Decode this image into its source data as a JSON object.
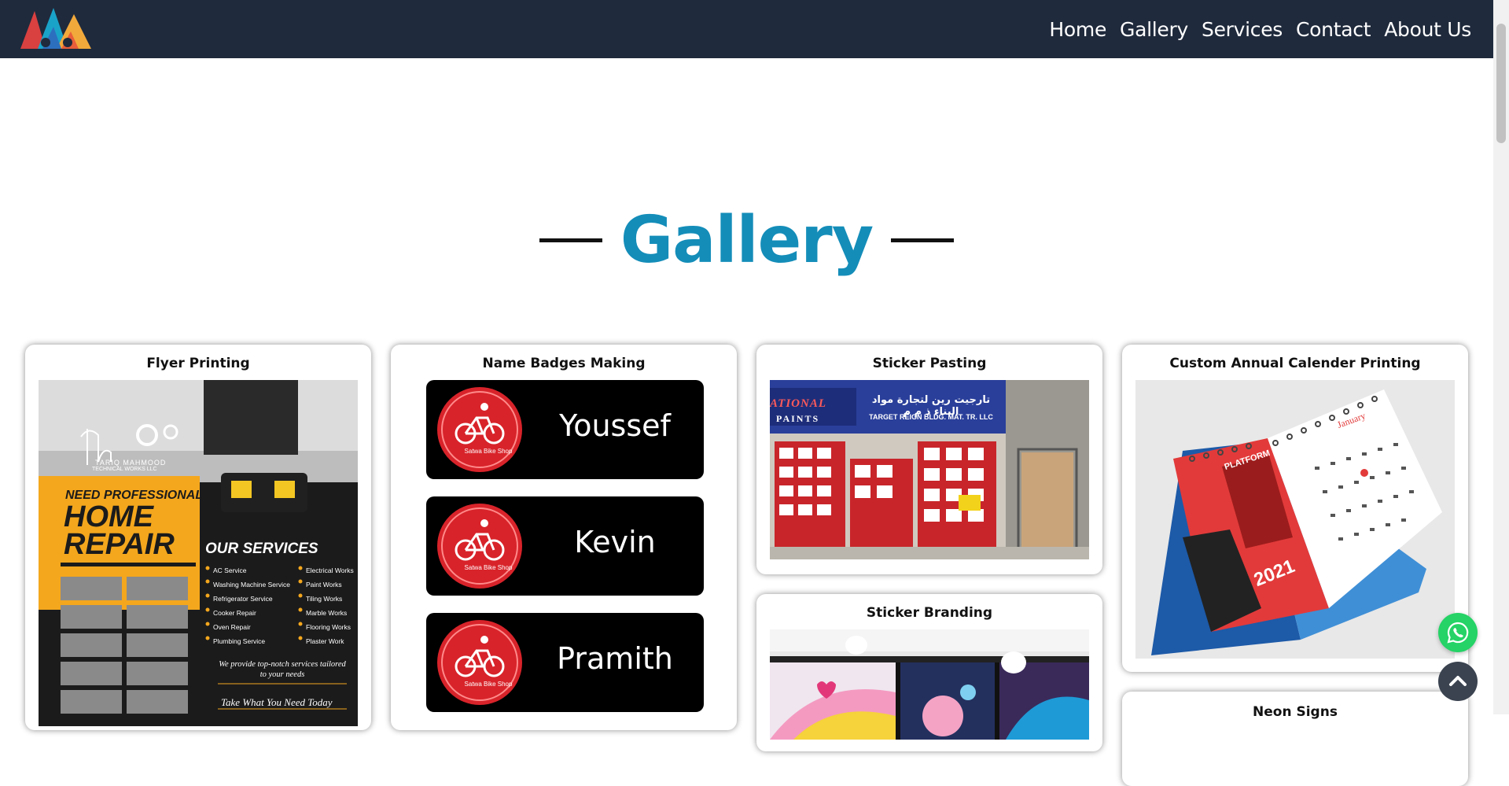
{
  "nav": {
    "logo_alt": "AAA logo",
    "links": [
      "Home",
      "Gallery",
      "Services",
      "Contact",
      "About Us"
    ]
  },
  "gallery": {
    "title": "Gallery"
  },
  "cards": {
    "flyer": {
      "title": "Flyer Printing",
      "brand": "TARIQ MAHMOOD",
      "brand_sub": "TECHNICAL WORKS LLC",
      "need": "NEED PROFESSIONAL",
      "home": "HOME",
      "repair": "REPAIR",
      "our_services": "OUR SERVICES",
      "services_left": [
        "AC Service",
        "Washing Machine Service",
        "Refrigerator Service",
        "Cooker Repair",
        "Oven Repair",
        "Plumbing Service"
      ],
      "services_right": [
        "Electrical Works",
        "Paint Works",
        "Tiling Works",
        "Marble Works",
        "Flooring Works",
        "Plaster Work"
      ],
      "tagline": "We provide top-notch services tailored to your needs",
      "slogan": "Take What You Need Today"
    },
    "badges": {
      "title": "Name Badges Making",
      "shop": "Satwa Bike Shop",
      "names": [
        "Youssef",
        "Kevin",
        "Pramith"
      ]
    },
    "sticker_pasting": {
      "title": "Sticker Pasting",
      "sign_left_1": "ATIONAL",
      "sign_left_2": "PAINTS",
      "sign_arabic": "تارجيت رين لتجارة مواد البناء ذ م م",
      "sign_english": "TARGET REIGN BLDG. MAT. TR. LLC"
    },
    "calendar": {
      "title": "Custom Annual Calender Printing",
      "month": "January",
      "year": "2021",
      "brand": "PLATFORM"
    },
    "sticker_branding": {
      "title": "Sticker Branding"
    },
    "neon": {
      "title": "Neon Signs"
    }
  },
  "colors": {
    "nav_bg": "#1f2a3c",
    "accent": "#148db9",
    "whatsapp": "#25d366",
    "scroll_top": "#3b4350"
  },
  "icons": {
    "whatsapp": "whatsapp-icon",
    "scroll_top": "chevron-up-icon"
  }
}
